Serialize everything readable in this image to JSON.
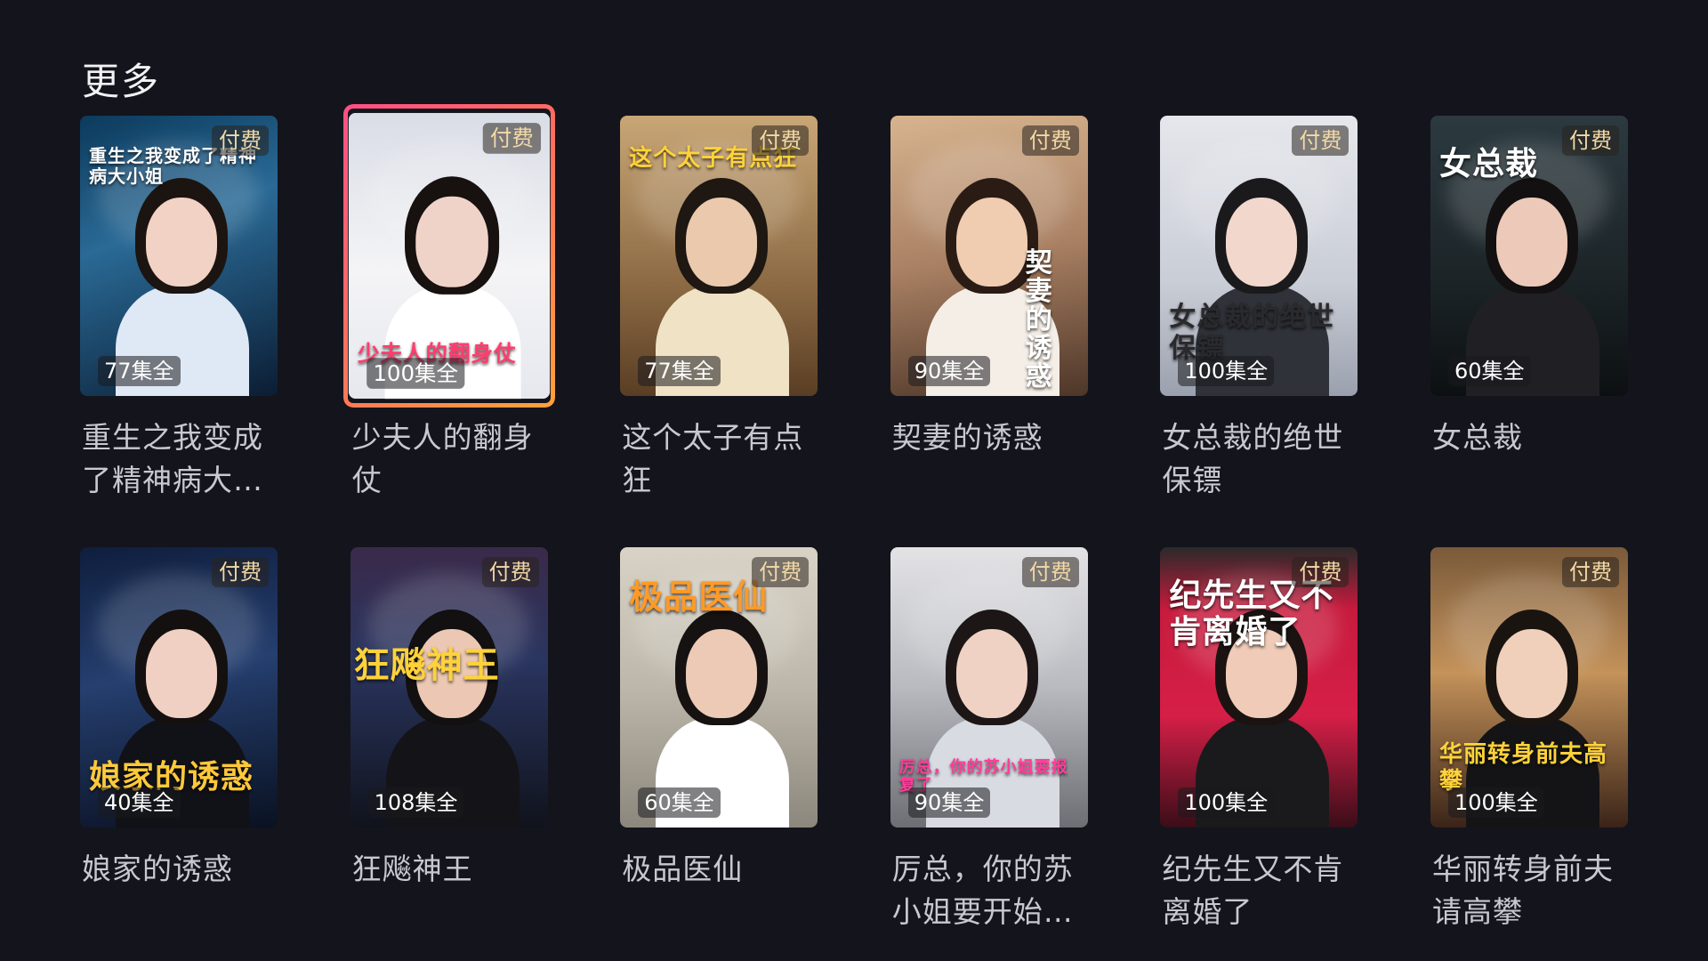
{
  "section": {
    "title": "更多"
  },
  "badges": {
    "paid": "付费"
  },
  "items": [
    {
      "title": "重生之我变成了精神病大小姐",
      "episodes": "77集全",
      "art_text": "重生之我变成了精神病大小姐",
      "theme": "blue"
    },
    {
      "title": "少夫人的翻身仗",
      "episodes": "100集全",
      "art_text": "少夫人的翻身仗",
      "theme": "white",
      "focused": true
    },
    {
      "title": "这个太子有点狂",
      "episodes": "77集全",
      "art_text": "这个太子有点狂",
      "theme": "palace"
    },
    {
      "title": "契妻的诱惑",
      "episodes": "90集全",
      "art_text": "契妻的诱惑",
      "theme": "warm"
    },
    {
      "title": "女总裁的绝世保镖",
      "episodes": "100集全",
      "art_text": "女总裁的绝世保镖",
      "theme": "silver"
    },
    {
      "title": "女总裁",
      "episodes": "60集全",
      "art_text": "女总裁",
      "theme": "dark"
    },
    {
      "title": "娘家的诱惑",
      "episodes": "40集全",
      "art_text": "娘家的诱惑",
      "theme": "night"
    },
    {
      "title": "狂飚神王",
      "episodes": "108集全",
      "art_text": "狂飚神王",
      "theme": "city"
    },
    {
      "title": "极品医仙",
      "episodes": "60集全",
      "art_text": "极品医仙",
      "theme": "clinic"
    },
    {
      "title": "厉总，你的苏小姐要开始报复了",
      "episodes": "90集全",
      "art_text": "厉总，你的苏小姐要报复了",
      "theme": "grey"
    },
    {
      "title": "纪先生又不肯离婚了",
      "episodes": "100集全",
      "art_text": "纪先生又不肯离婚了",
      "theme": "red"
    },
    {
      "title": "华丽转身前夫请高攀",
      "episodes": "100集全",
      "art_text": "华丽转身前夫高攀",
      "theme": "church"
    }
  ]
}
